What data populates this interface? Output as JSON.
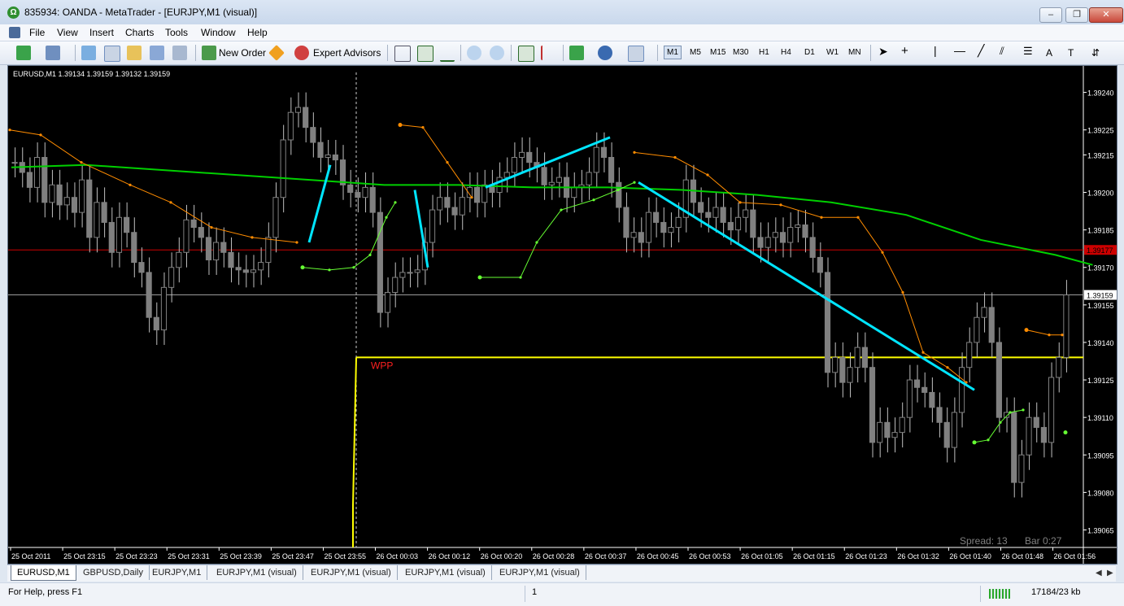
{
  "window": {
    "title": "835934: OANDA - MetaTrader - [EURJPY,M1 (visual)]",
    "app_icon": "oanda-logo-icon",
    "controls": {
      "minimize": "–",
      "restore": "❐",
      "close": "✕"
    }
  },
  "menu": {
    "items": [
      "File",
      "View",
      "Insert",
      "Charts",
      "Tools",
      "Window",
      "Help"
    ]
  },
  "toolbar": {
    "new_order_label": "New Order",
    "expert_advisors_label": "Expert Advisors",
    "timeframes": [
      "M1",
      "M5",
      "M15",
      "M30",
      "H1",
      "H4",
      "D1",
      "W1",
      "MN"
    ],
    "active_timeframe": "M1",
    "drawing_tools": [
      "cursor-icon",
      "crosshair-icon",
      "vertical-line-icon",
      "horizontal-line-icon",
      "trendline-icon",
      "equidistant-channel-icon",
      "fibonacci-icon",
      "text-label-icon",
      "text-tool-icon",
      "arrows-icon"
    ]
  },
  "chart": {
    "header": "EURUSD,M1  1.39134 1.39159 1.39132 1.39159",
    "wpp_label": "WPP",
    "spread_text": "Spread: 13",
    "bar_text": "Bar  0:27",
    "colors": {
      "background": "#000000",
      "candle": "#808080",
      "ma_green": "#00d000",
      "sar_orange": "#ff8c00",
      "sar_green": "#66ff33",
      "trendline": "#00e5ff",
      "yellow_line": "#ffff00",
      "red_line": "#cc0000",
      "grey_line": "#9a9a9a"
    },
    "red_line_price_tag": "1.39177",
    "grey_line_price_tag": "1.39159"
  },
  "chart_data": {
    "type": "candlestick",
    "symbol": "EURUSD,M1",
    "ohlc_last": {
      "open": 1.39134,
      "high": 1.39159,
      "low": 1.39132,
      "close": 1.39159
    },
    "y_axis": {
      "ticks": [
        "1.39240",
        "1.39225",
        "1.39215",
        "1.39200",
        "1.39185",
        "1.39170",
        "1.39155",
        "1.39140",
        "1.39125",
        "1.39110",
        "1.39095",
        "1.39080",
        "1.39065"
      ],
      "tick_values": [
        1.3924,
        1.39225,
        1.39215,
        1.392,
        1.39185,
        1.3917,
        1.39155,
        1.3914,
        1.39125,
        1.3911,
        1.39095,
        1.3908,
        1.39065
      ],
      "ylim": [
        1.39058,
        1.39248
      ]
    },
    "x_axis": {
      "ticks": [
        "25 Oct 2011",
        "25 Oct 23:15",
        "25 Oct 23:23",
        "25 Oct 23:31",
        "25 Oct 23:39",
        "25 Oct 23:47",
        "25 Oct 23:55",
        "26 Oct 00:03",
        "26 Oct 00:12",
        "26 Oct 00:20",
        "26 Oct 00:28",
        "26 Oct 00:37",
        "26 Oct 00:45",
        "26 Oct 00:53",
        "26 Oct 01:05",
        "26 Oct 01:15",
        "26 Oct 01:23",
        "26 Oct 01:32",
        "26 Oct 01:40",
        "26 Oct 01:48",
        "26 Oct 01:56"
      ]
    },
    "horizontal_lines": [
      {
        "name": "red",
        "price": 1.39177
      },
      {
        "name": "grey",
        "price": 1.39159
      },
      {
        "name": "yellow",
        "price": 1.39134
      }
    ],
    "close_series": [
      1.39212,
      1.39208,
      1.39202,
      1.39214,
      1.39196,
      1.39203,
      1.39195,
      1.39198,
      1.39192,
      1.39205,
      1.39182,
      1.39196,
      1.39188,
      1.39176,
      1.3919,
      1.39184,
      1.39172,
      1.39168,
      1.3915,
      1.39145,
      1.39162,
      1.3917,
      1.39176,
      1.39189,
      1.39186,
      1.39182,
      1.39173,
      1.3918,
      1.39176,
      1.3917,
      1.39169,
      1.39168,
      1.39169,
      1.39172,
      1.39182,
      1.39198,
      1.39221,
      1.39232,
      1.39234,
      1.39226,
      1.3922,
      1.39214,
      1.39215,
      1.39213,
      1.39203,
      1.392,
      1.39198,
      1.39202,
      1.39192,
      1.39152,
      1.3916,
      1.39166,
      1.39168,
      1.39168,
      1.39169,
      1.3918,
      1.39193,
      1.39198,
      1.39194,
      1.39191,
      1.39198,
      1.39202,
      1.39196,
      1.39203,
      1.392,
      1.39206,
      1.39208,
      1.39214,
      1.39216,
      1.39212,
      1.3921,
      1.39203,
      1.39204,
      1.39206,
      1.39198,
      1.39202,
      1.39203,
      1.39208,
      1.39218,
      1.39214,
      1.39204,
      1.39194,
      1.39182,
      1.39184,
      1.3918,
      1.39192,
      1.39188,
      1.39184,
      1.39186,
      1.3919,
      1.39205,
      1.39196,
      1.39192,
      1.3919,
      1.39194,
      1.39188,
      1.39185,
      1.3919,
      1.39193,
      1.39182,
      1.39178,
      1.39182,
      1.39184,
      1.3918,
      1.39186,
      1.39187,
      1.39182,
      1.39174,
      1.39168,
      1.39128,
      1.39134,
      1.39124,
      1.3913,
      1.39138,
      1.3913,
      1.391,
      1.39108,
      1.39102,
      1.39104,
      1.3911,
      1.39125,
      1.39122,
      1.3912,
      1.39114,
      1.39108,
      1.39098,
      1.39112,
      1.3913,
      1.3914,
      1.3915,
      1.39154,
      1.3914,
      1.3911,
      1.39112,
      1.39084,
      1.39095,
      1.3911,
      1.39106,
      1.391,
      1.39126,
      1.39134,
      1.39159
    ],
    "ma_series_points": [
      [
        0,
        1.3921
      ],
      [
        10,
        1.39211
      ],
      [
        20,
        1.39209
      ],
      [
        30,
        1.39207
      ],
      [
        40,
        1.39205
      ],
      [
        50,
        1.39203
      ],
      [
        60,
        1.39203
      ],
      [
        70,
        1.39202
      ],
      [
        80,
        1.39202
      ],
      [
        90,
        1.39201
      ],
      [
        100,
        1.39199
      ],
      [
        110,
        1.39196
      ],
      [
        120,
        1.39191
      ],
      [
        130,
        1.39181
      ],
      [
        140,
        1.39175
      ],
      [
        145,
        1.39171
      ]
    ],
    "psar_orange_start_price": 1.39225,
    "psar_green_last": 1.39104
  }
}
